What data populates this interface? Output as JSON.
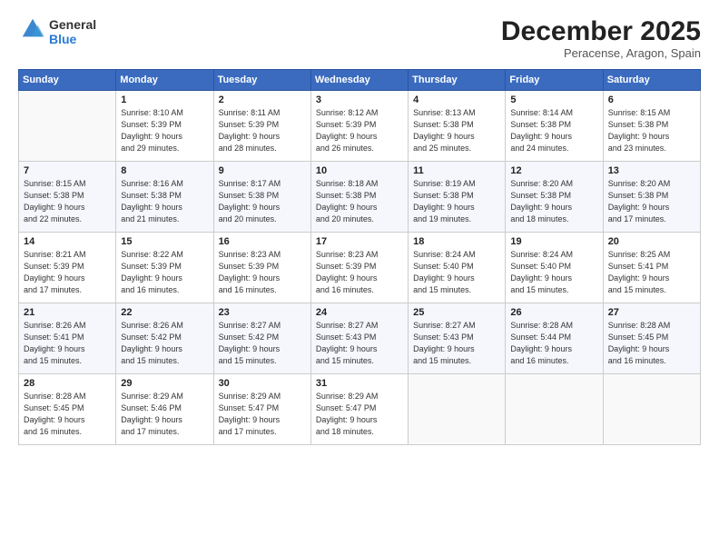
{
  "header": {
    "logo_general": "General",
    "logo_blue": "Blue",
    "month": "December 2025",
    "location": "Peracense, Aragon, Spain"
  },
  "weekdays": [
    "Sunday",
    "Monday",
    "Tuesday",
    "Wednesday",
    "Thursday",
    "Friday",
    "Saturday"
  ],
  "weeks": [
    [
      {
        "day": "",
        "info": ""
      },
      {
        "day": "1",
        "info": "Sunrise: 8:10 AM\nSunset: 5:39 PM\nDaylight: 9 hours\nand 29 minutes."
      },
      {
        "day": "2",
        "info": "Sunrise: 8:11 AM\nSunset: 5:39 PM\nDaylight: 9 hours\nand 28 minutes."
      },
      {
        "day": "3",
        "info": "Sunrise: 8:12 AM\nSunset: 5:39 PM\nDaylight: 9 hours\nand 26 minutes."
      },
      {
        "day": "4",
        "info": "Sunrise: 8:13 AM\nSunset: 5:38 PM\nDaylight: 9 hours\nand 25 minutes."
      },
      {
        "day": "5",
        "info": "Sunrise: 8:14 AM\nSunset: 5:38 PM\nDaylight: 9 hours\nand 24 minutes."
      },
      {
        "day": "6",
        "info": "Sunrise: 8:15 AM\nSunset: 5:38 PM\nDaylight: 9 hours\nand 23 minutes."
      }
    ],
    [
      {
        "day": "7",
        "info": "Sunrise: 8:15 AM\nSunset: 5:38 PM\nDaylight: 9 hours\nand 22 minutes."
      },
      {
        "day": "8",
        "info": "Sunrise: 8:16 AM\nSunset: 5:38 PM\nDaylight: 9 hours\nand 21 minutes."
      },
      {
        "day": "9",
        "info": "Sunrise: 8:17 AM\nSunset: 5:38 PM\nDaylight: 9 hours\nand 20 minutes."
      },
      {
        "day": "10",
        "info": "Sunrise: 8:18 AM\nSunset: 5:38 PM\nDaylight: 9 hours\nand 20 minutes."
      },
      {
        "day": "11",
        "info": "Sunrise: 8:19 AM\nSunset: 5:38 PM\nDaylight: 9 hours\nand 19 minutes."
      },
      {
        "day": "12",
        "info": "Sunrise: 8:20 AM\nSunset: 5:38 PM\nDaylight: 9 hours\nand 18 minutes."
      },
      {
        "day": "13",
        "info": "Sunrise: 8:20 AM\nSunset: 5:38 PM\nDaylight: 9 hours\nand 17 minutes."
      }
    ],
    [
      {
        "day": "14",
        "info": "Sunrise: 8:21 AM\nSunset: 5:39 PM\nDaylight: 9 hours\nand 17 minutes."
      },
      {
        "day": "15",
        "info": "Sunrise: 8:22 AM\nSunset: 5:39 PM\nDaylight: 9 hours\nand 16 minutes."
      },
      {
        "day": "16",
        "info": "Sunrise: 8:23 AM\nSunset: 5:39 PM\nDaylight: 9 hours\nand 16 minutes."
      },
      {
        "day": "17",
        "info": "Sunrise: 8:23 AM\nSunset: 5:39 PM\nDaylight: 9 hours\nand 16 minutes."
      },
      {
        "day": "18",
        "info": "Sunrise: 8:24 AM\nSunset: 5:40 PM\nDaylight: 9 hours\nand 15 minutes."
      },
      {
        "day": "19",
        "info": "Sunrise: 8:24 AM\nSunset: 5:40 PM\nDaylight: 9 hours\nand 15 minutes."
      },
      {
        "day": "20",
        "info": "Sunrise: 8:25 AM\nSunset: 5:41 PM\nDaylight: 9 hours\nand 15 minutes."
      }
    ],
    [
      {
        "day": "21",
        "info": "Sunrise: 8:26 AM\nSunset: 5:41 PM\nDaylight: 9 hours\nand 15 minutes."
      },
      {
        "day": "22",
        "info": "Sunrise: 8:26 AM\nSunset: 5:42 PM\nDaylight: 9 hours\nand 15 minutes."
      },
      {
        "day": "23",
        "info": "Sunrise: 8:27 AM\nSunset: 5:42 PM\nDaylight: 9 hours\nand 15 minutes."
      },
      {
        "day": "24",
        "info": "Sunrise: 8:27 AM\nSunset: 5:43 PM\nDaylight: 9 hours\nand 15 minutes."
      },
      {
        "day": "25",
        "info": "Sunrise: 8:27 AM\nSunset: 5:43 PM\nDaylight: 9 hours\nand 15 minutes."
      },
      {
        "day": "26",
        "info": "Sunrise: 8:28 AM\nSunset: 5:44 PM\nDaylight: 9 hours\nand 16 minutes."
      },
      {
        "day": "27",
        "info": "Sunrise: 8:28 AM\nSunset: 5:45 PM\nDaylight: 9 hours\nand 16 minutes."
      }
    ],
    [
      {
        "day": "28",
        "info": "Sunrise: 8:28 AM\nSunset: 5:45 PM\nDaylight: 9 hours\nand 16 minutes."
      },
      {
        "day": "29",
        "info": "Sunrise: 8:29 AM\nSunset: 5:46 PM\nDaylight: 9 hours\nand 17 minutes."
      },
      {
        "day": "30",
        "info": "Sunrise: 8:29 AM\nSunset: 5:47 PM\nDaylight: 9 hours\nand 17 minutes."
      },
      {
        "day": "31",
        "info": "Sunrise: 8:29 AM\nSunset: 5:47 PM\nDaylight: 9 hours\nand 18 minutes."
      },
      {
        "day": "",
        "info": ""
      },
      {
        "day": "",
        "info": ""
      },
      {
        "day": "",
        "info": ""
      }
    ]
  ]
}
